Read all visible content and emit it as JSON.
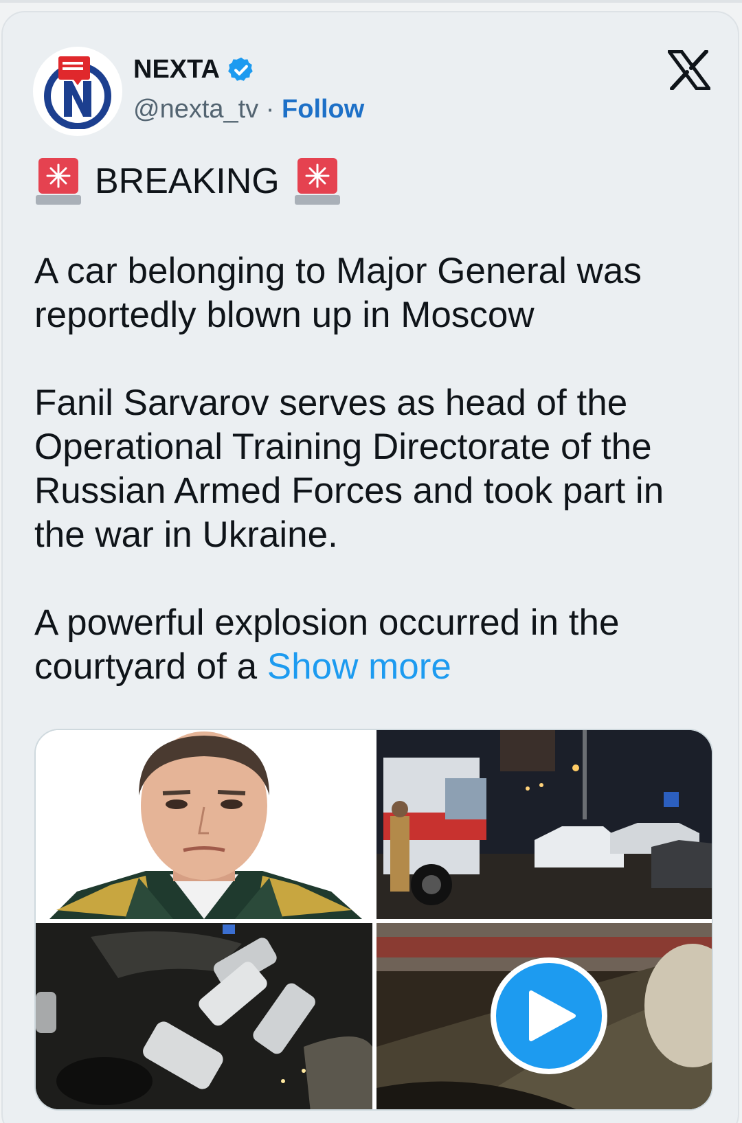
{
  "author": {
    "name": "NEXTA",
    "handle": "@nexta_tv",
    "separator": "·",
    "follow_label": "Follow",
    "avatar_letter": "N"
  },
  "brand_icon": "x-logo-icon",
  "post": {
    "breaking": "BREAKING",
    "paragraphs": [
      "A car belonging to Major General was reportedly blown up in Moscow",
      "Fanil Sarvarov serves as head of the Operational Training Directorate of the Russian Armed Forces and took part in the war in Ukraine."
    ],
    "truncated_text": "A powerful explosion occurred in the courtyard of a ",
    "show_more_label": "Show more"
  },
  "media": [
    {
      "kind": "photo",
      "name": "portrait-photo"
    },
    {
      "kind": "photo",
      "name": "fire-truck-scene-photo"
    },
    {
      "kind": "photo",
      "name": "aerial-parking-photo"
    },
    {
      "kind": "video",
      "name": "ambulance-video"
    }
  ],
  "colors": {
    "accent": "#1d9bf0",
    "follow": "#1d70c7",
    "text": "#0f1419",
    "muted": "#536471",
    "card_bg": "#ebeff2"
  }
}
